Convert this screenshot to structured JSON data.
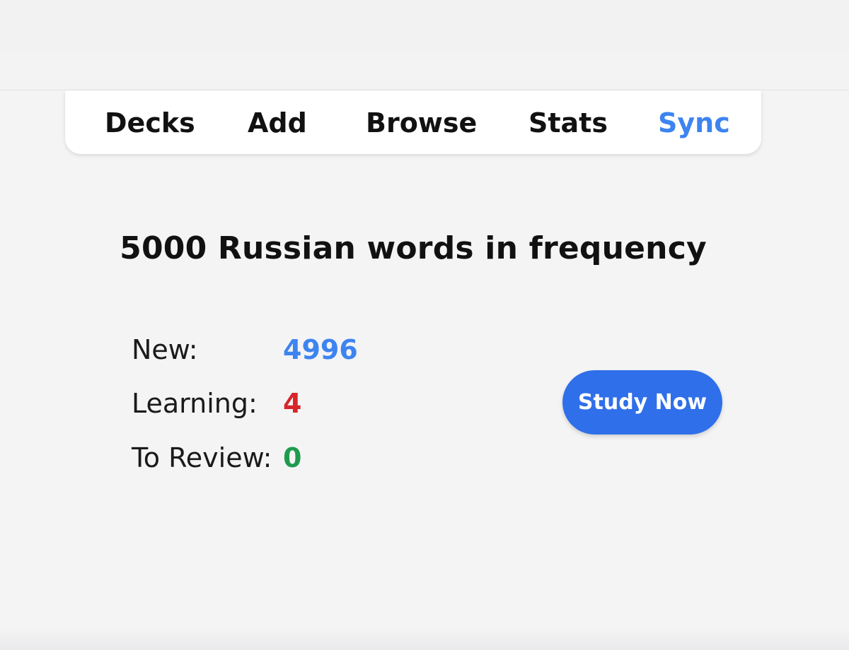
{
  "toolbar": {
    "tabs": {
      "decks": "Decks",
      "add": "Add",
      "browse": "Browse",
      "stats": "Stats",
      "sync": "Sync"
    }
  },
  "deck": {
    "title": "5000 Russian words in frequency",
    "stats": {
      "new_label": "New:",
      "new_count": "4996",
      "learning_label": "Learning:",
      "learning_count": "4",
      "review_label": "To Review:",
      "review_count": "0"
    },
    "study_button_label": "Study Now"
  },
  "colors": {
    "accent_blue": "#3d84f0",
    "button_blue": "#2f6fe9",
    "new_blue": "#3d84f0",
    "learning_red": "#d6262b",
    "review_green": "#1f9b4f"
  }
}
